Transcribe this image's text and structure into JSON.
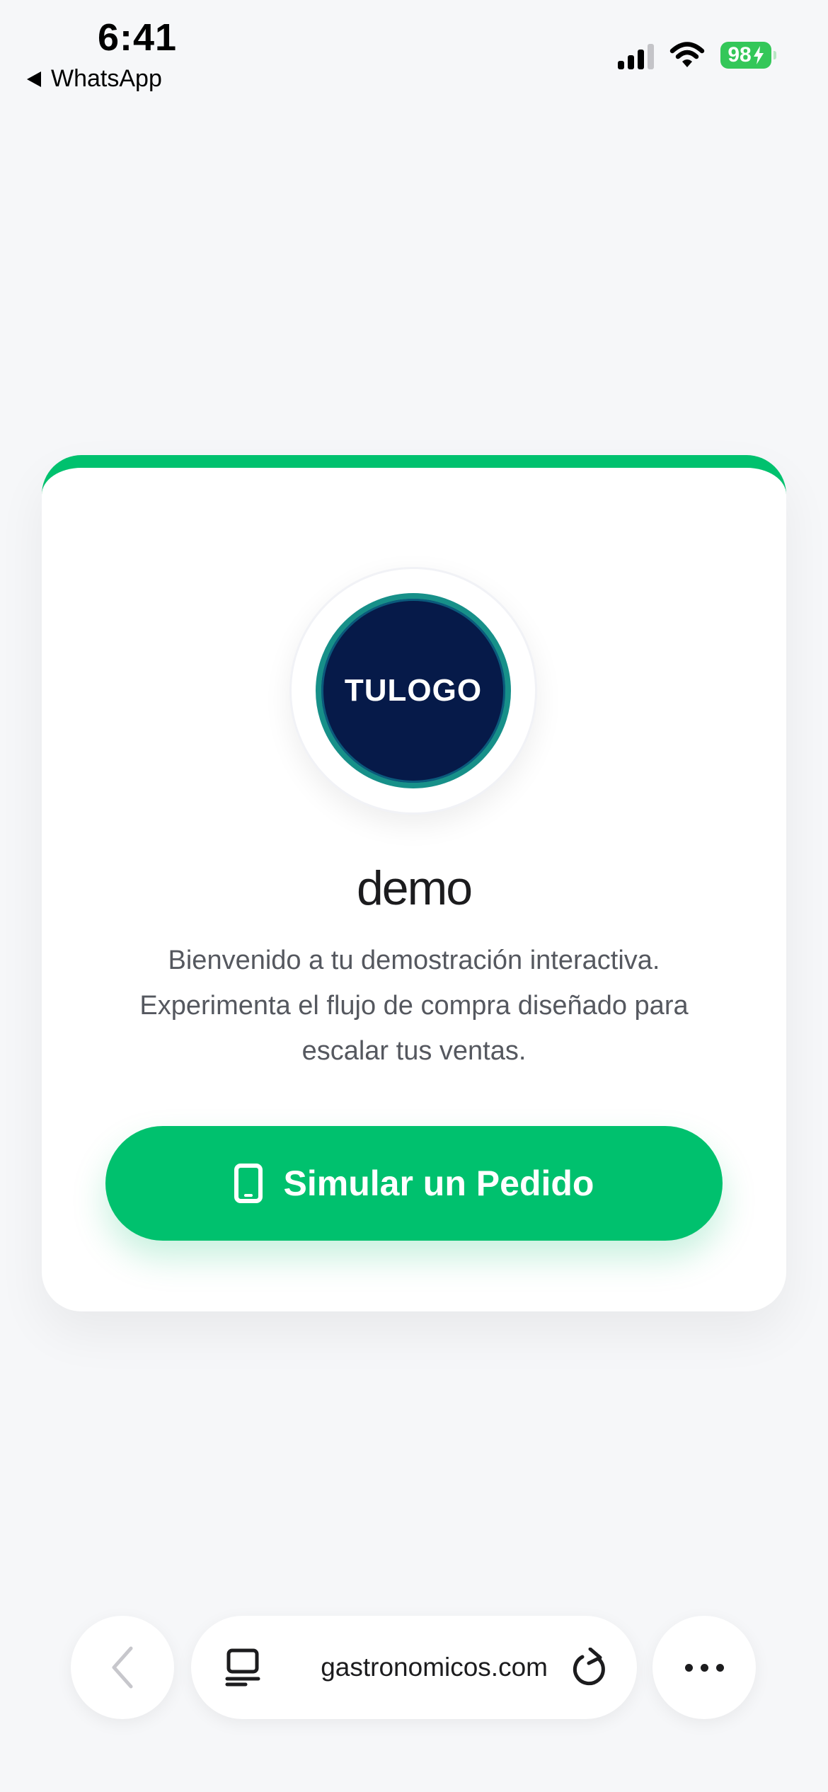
{
  "status_bar": {
    "time": "6:41",
    "back_app": "WhatsApp",
    "battery": "98",
    "battery_color": "#34c759"
  },
  "card": {
    "accent_color": "#00c16e",
    "logo_text": "TULOGO",
    "brand_name": "demo",
    "welcome_text": "Bienvenido a tu demostración interactiva. Experimenta el flujo de compra diseñado para escalar tus ventas.",
    "cta_label": "Simular un Pedido",
    "cta_icon": "smartphone-icon"
  },
  "browser": {
    "url": "gastronomicos.com",
    "back_icon": "chevron-left-icon",
    "tabs_icon": "page-menu-icon",
    "reload_icon": "reload-icon",
    "more_icon": "more-icon"
  }
}
